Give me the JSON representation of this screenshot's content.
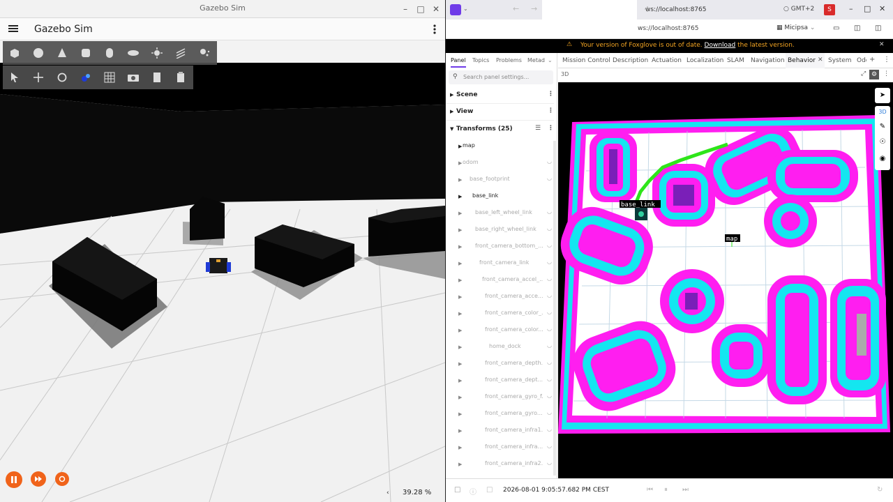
{
  "gazebo": {
    "window_title": "Gazebo Sim",
    "app_title": "Gazebo Sim",
    "rtf": "39.28 %",
    "colors": {
      "accent": "#f0631a",
      "toolbar": "#4e4e4e"
    },
    "toolbar_row1_icons": [
      "box-icon",
      "sphere-icon",
      "cone-icon",
      "cylinder-icon",
      "capsule-icon",
      "ellipsoid-icon",
      "sun-icon",
      "directional-light-icon",
      "spot-light-icon"
    ],
    "toolbar_row2_icons": [
      "select-icon",
      "translate-icon",
      "rotate-icon",
      "snap-icon",
      "grid-icon",
      "camera-icon",
      "copy-icon",
      "paste-icon"
    ]
  },
  "foxglove": {
    "tab_url": "ws://localhost:8765",
    "address_url": "ws://localhost:8765",
    "timezone": "GMT+2",
    "user_initial": "S",
    "layout_name": "Micipsa",
    "warning": {
      "text": "Your version of Foxglove is out of date.",
      "link": "Download",
      "suffix": "the latest version."
    },
    "left_tabs": [
      "Panel",
      "Topics",
      "Problems",
      "Metad"
    ],
    "search_placeholder": "Search panel settings...",
    "sections": {
      "scene": "Scene",
      "view": "View",
      "transforms": "Transforms (25)"
    },
    "frames": [
      "map",
      "odom",
      "base_footprint",
      "base_link",
      "base_left_wheel_link",
      "base_right_wheel_link",
      "front_camera_bottom_...",
      "front_camera_link",
      "front_camera_accel_...",
      "front_camera_acce...",
      "front_camera_color_...",
      "front_camera_color...",
      "home_dock",
      "front_camera_depth...",
      "front_camera_dept...",
      "front_camera_gyro_f...",
      "front_camera_gyro...",
      "front_camera_infra1...",
      "front_camera_infra...",
      "front_camera_infra2..."
    ],
    "right_tabs": [
      "Mission Control",
      "Description",
      "Actuation",
      "Localization",
      "SLAM",
      "Navigation",
      "Behavior",
      "System",
      "Odo"
    ],
    "active_tab": "Behavior",
    "panel_title": "3D",
    "viewport_labels": {
      "robot": "base_link",
      "map": "map",
      "mode": "3D"
    },
    "timestamp": "2026-08-01 9:05:57.682 PM CEST",
    "colors": {
      "costmap_cyan": "#14e6f0",
      "costmap_magenta": "#ff1ef0",
      "costmap_purple": "#7a1fb8",
      "path": "#2ee51a",
      "warning_text": "#f5a623"
    }
  }
}
